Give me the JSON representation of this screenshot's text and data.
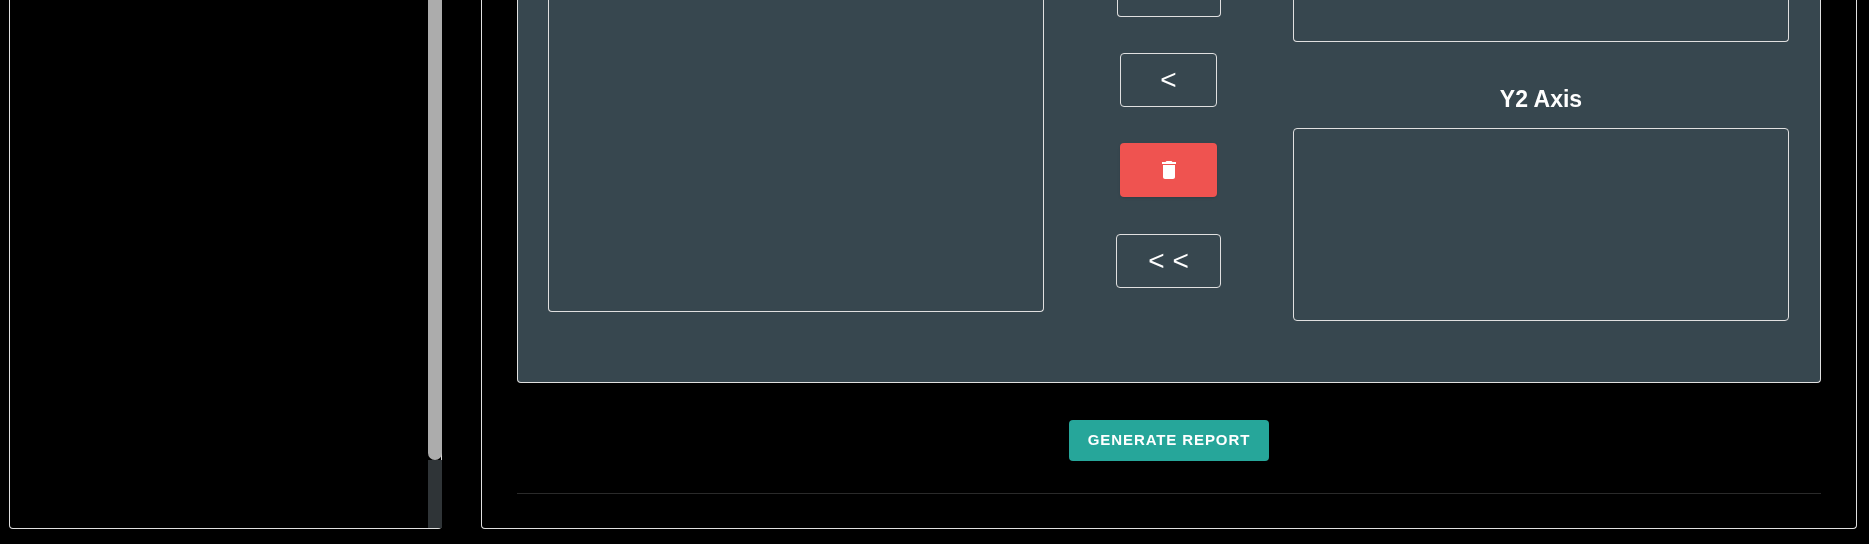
{
  "transfer_buttons": [
    {
      "kind": "cut"
    },
    {
      "kind": "text",
      "label": "<"
    },
    {
      "kind": "delete"
    },
    {
      "kind": "text",
      "label": "< <"
    }
  ],
  "y2_axis": {
    "title": "Y2 Axis"
  },
  "generate_button": {
    "label": "GENERATE REPORT"
  }
}
